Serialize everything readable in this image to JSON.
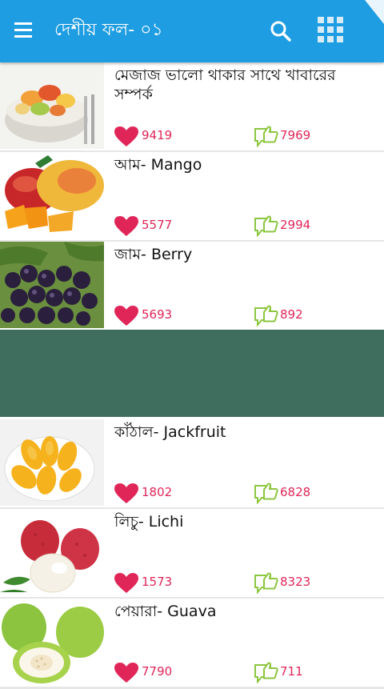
{
  "appbar": {
    "title": "দেশীয় ফল- ০১",
    "color": "#1e9de2"
  },
  "accent": "#e02658",
  "items_top": [
    {
      "title": "মেজাজ ভালো থাকার সাথে খাবারের সম্পর্ক",
      "likes": "9419",
      "thumbs_up": "7969"
    },
    {
      "title": "আম- Mango",
      "likes": "5577",
      "thumbs_up": "2994"
    },
    {
      "title": "জাম- Berry",
      "likes": "5693",
      "thumbs_up": "892"
    }
  ],
  "items_bottom": [
    {
      "title": "কাঁঠাল- Jackfruit",
      "likes": "1802",
      "thumbs_up": "6828"
    },
    {
      "title": "লিচু- Lichi",
      "likes": "1573",
      "thumbs_up": "8323"
    },
    {
      "title": "পেয়ারা- Guava",
      "likes": "7790",
      "thumbs_up": "711"
    }
  ],
  "icons": {
    "menu": "menu-icon",
    "search": "search-icon",
    "grid": "grid-icon",
    "like": "heart-icon",
    "thumbs": "thumbs-up-icon"
  },
  "ad_banner_color": "#3f6d5e"
}
